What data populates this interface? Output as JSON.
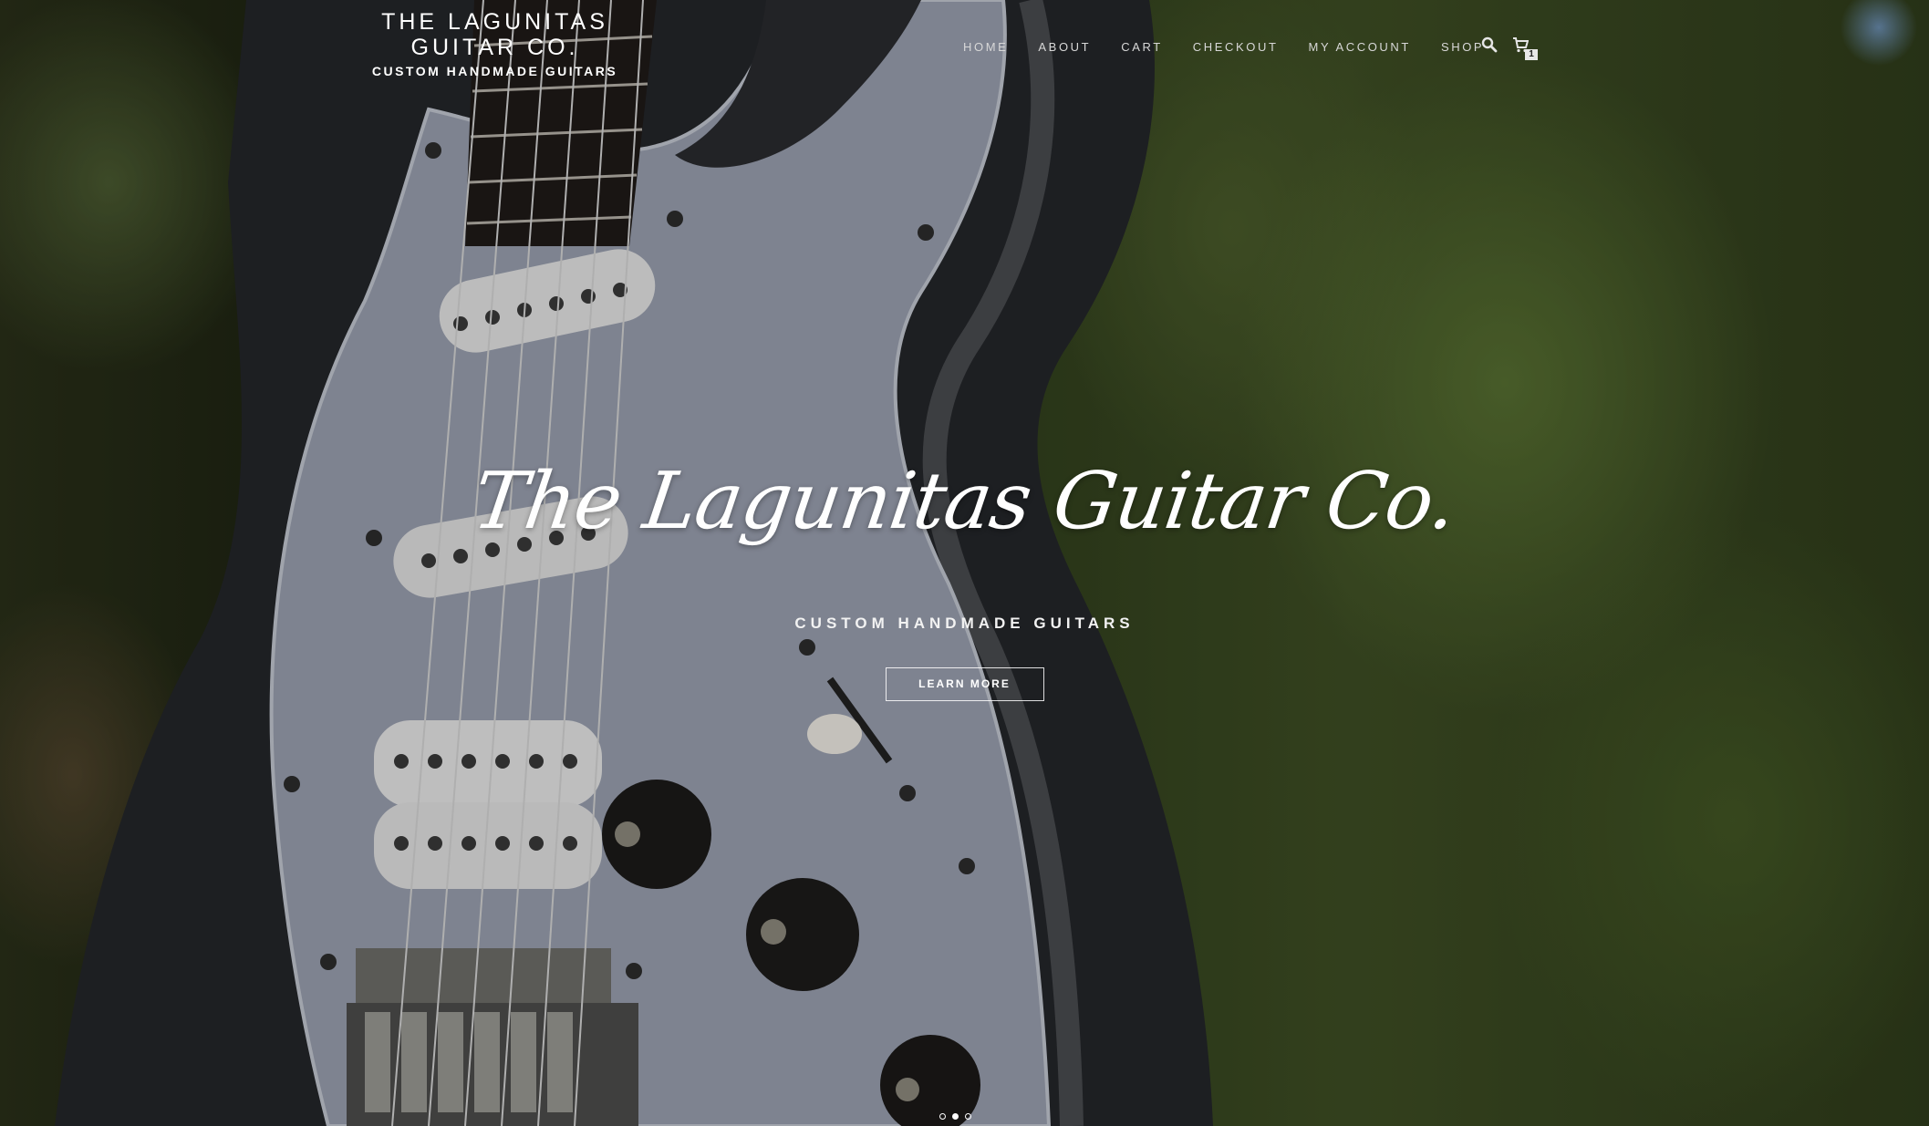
{
  "header": {
    "site_title": "THE LAGUNITAS GUITAR CO.",
    "tagline": "CUSTOM HANDMADE GUITARS"
  },
  "nav": {
    "items": [
      {
        "label": "HOME"
      },
      {
        "label": "ABOUT"
      },
      {
        "label": "CART"
      },
      {
        "label": "CHECKOUT"
      },
      {
        "label": "MY ACCOUNT"
      },
      {
        "label": "SHOP"
      }
    ],
    "search_icon": "search-icon",
    "cart_icon": "cart-icon",
    "cart_count": "1"
  },
  "hero": {
    "title": "The Lagunitas Guitar Co.",
    "subtitle": "CUSTOM HANDMADE GUITARS",
    "button_label": "LEARN MORE"
  },
  "slider": {
    "total_slides": 3,
    "active_slide": 2
  },
  "colors": {
    "text": "#ffffff",
    "nav_text": "#d8d8d8"
  }
}
